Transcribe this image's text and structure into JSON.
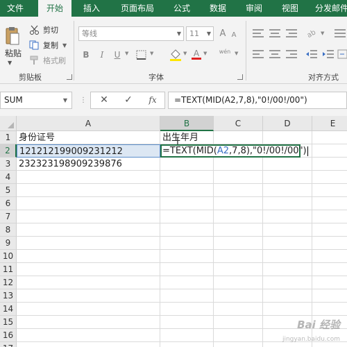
{
  "ribbon": {
    "tabs": [
      "文件",
      "开始",
      "插入",
      "页面布局",
      "公式",
      "数据",
      "审阅",
      "视图",
      "分发邮件"
    ],
    "active_tab": 1,
    "clipboard": {
      "paste": "粘贴",
      "cut": "剪切",
      "copy": "复制",
      "format_painter": "格式刷",
      "group_label": "剪贴板"
    },
    "font": {
      "name": "等线",
      "size": "11",
      "grow": "A",
      "shrink": "A",
      "bold": "B",
      "italic": "I",
      "underline": "U",
      "color_a": "A",
      "phonetic": "wén",
      "group_label": "字体"
    },
    "alignment": {
      "group_label": "对齐方式"
    }
  },
  "formula_bar": {
    "name_box": "SUM",
    "cancel": "✕",
    "enter": "✓",
    "fx": "fx",
    "formula": "=TEXT(MID(A2,7,8),\"0!/00!/00\")"
  },
  "sheet": {
    "columns": [
      "A",
      "B",
      "C",
      "D",
      "E"
    ],
    "rows": [
      "1",
      "2",
      "3",
      "4",
      "5",
      "6",
      "7",
      "8",
      "9",
      "10",
      "11",
      "12",
      "13",
      "14",
      "15",
      "16",
      "17"
    ],
    "cells": {
      "A1": "身份证号",
      "B1": "出生年月",
      "A2": "121212199009231212",
      "A3": "232323198909239876"
    },
    "edit_cell": {
      "prefix": "=TEXT(MID(",
      "ref": "A2",
      "suffix": ",7,8),\"0!/00!/00\")"
    }
  },
  "watermark": {
    "main": "Bai 经验",
    "sub": "jingyan.baidu.com"
  },
  "colors": {
    "accent": "#217346",
    "selection": "#dce7f3",
    "ref_blue": "#3a6fc4"
  }
}
